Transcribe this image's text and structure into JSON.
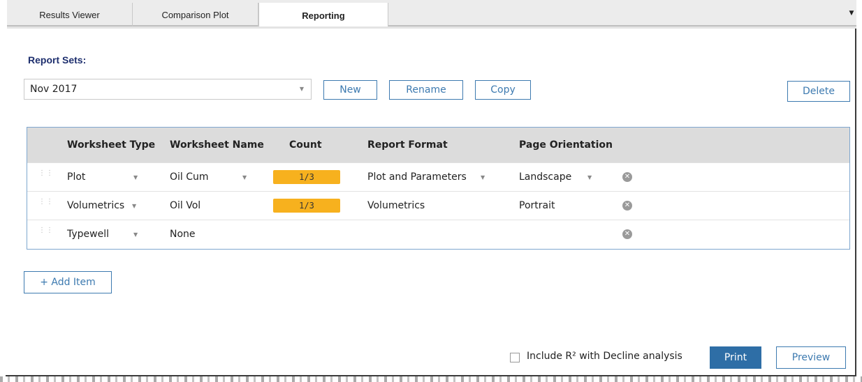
{
  "tabs": [
    {
      "label": "Results Viewer"
    },
    {
      "label": "Comparison Plot"
    },
    {
      "label": "Reporting"
    }
  ],
  "report_sets": {
    "label": "Report Sets:",
    "selected": "Nov 2017"
  },
  "buttons": {
    "new": "New",
    "rename": "Rename",
    "copy": "Copy",
    "delete": "Delete",
    "add_item": "+ Add Item",
    "print": "Print",
    "preview": "Preview"
  },
  "table": {
    "headers": {
      "worksheet_type": "Worksheet Type",
      "worksheet_name": "Worksheet Name",
      "count": "Count",
      "report_format": "Report Format",
      "page_orientation": "Page Orientation"
    },
    "rows": [
      {
        "type": "Plot",
        "name": "Oil Cum",
        "count": "1/3",
        "format": "Plot and Parameters",
        "orientation": "Landscape"
      },
      {
        "type": "Volumetrics",
        "name": "Oil Vol",
        "count": "1/3",
        "format": "Volumetrics",
        "orientation": "Portrait"
      },
      {
        "type": "Typewell",
        "name": "None",
        "count": "",
        "format": "",
        "orientation": ""
      }
    ]
  },
  "options": {
    "include_r2_label": "Include R² with Decline analysis",
    "include_r2_checked": false
  },
  "colors": {
    "accent": "#2e6ea6",
    "badge": "#f7b11e",
    "heading": "#1e2f6e"
  }
}
